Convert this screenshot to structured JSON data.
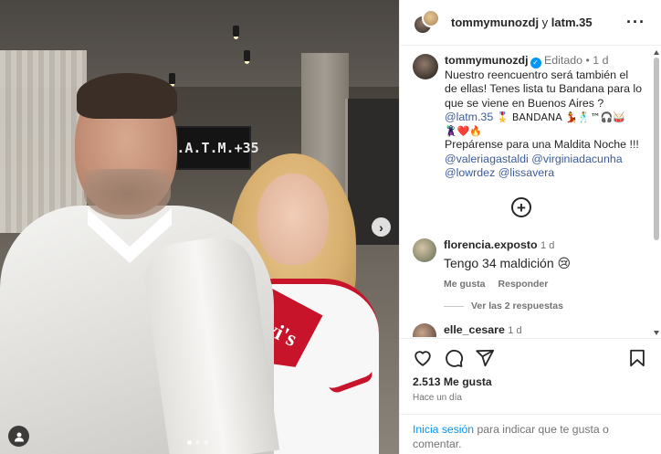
{
  "photo": {
    "tv_text": "L.A.T.M.+35",
    "shirt_logo": "Levi's",
    "next_icon": "chevron-right-icon",
    "tag_icon": "user-icon",
    "carousel": {
      "count": 3,
      "active": 0
    }
  },
  "header": {
    "user1": "tommymunozdj",
    "and": " y ",
    "user2": "latm.35",
    "more_icon": "more-horizontal-icon"
  },
  "caption": {
    "username": "tommymunozdj",
    "edited": "Editado",
    "sep": " • ",
    "time": "1 d",
    "line1": "Nuestro reencuentro será también el de ellas! Tenes lista tu Bandana para lo que se viene en Buenos Aires ?",
    "mention1": "@latm.35",
    "bandana": "🎖️ BANDANA 💃🕺™🎧🥁",
    "emojis2": "🦹‍♂️❤️🔥",
    "line2": "Prepárense para una Maldita Noche !!!",
    "mentions": [
      "@valeriagastaldi",
      "@virginiadacunha",
      "@lowrdez",
      "@lissavera"
    ]
  },
  "add_comment_icon": "plus-circle-icon",
  "comments": [
    {
      "username": "florencia.exposto",
      "time": "1 d",
      "text": "Tengo 34 maldición 😢",
      "like_label": "Me gusta",
      "reply_label": "Responder"
    },
    {
      "username": "elle_cesare",
      "time": "1 d"
    }
  ],
  "view_replies": "Ver las 2 respuestas",
  "actions": {
    "like_icon": "heart-icon",
    "comment_icon": "comment-icon",
    "share_icon": "send-icon",
    "save_icon": "bookmark-icon",
    "likes": "2.513 Me gusta",
    "time_ago": "Hace un día",
    "login_link": "Inicia sesión",
    "login_text": " para indicar que te gusta o comentar."
  },
  "colors": {
    "link": "#0095f6",
    "verified": "#0095f6",
    "muted": "#737373"
  }
}
